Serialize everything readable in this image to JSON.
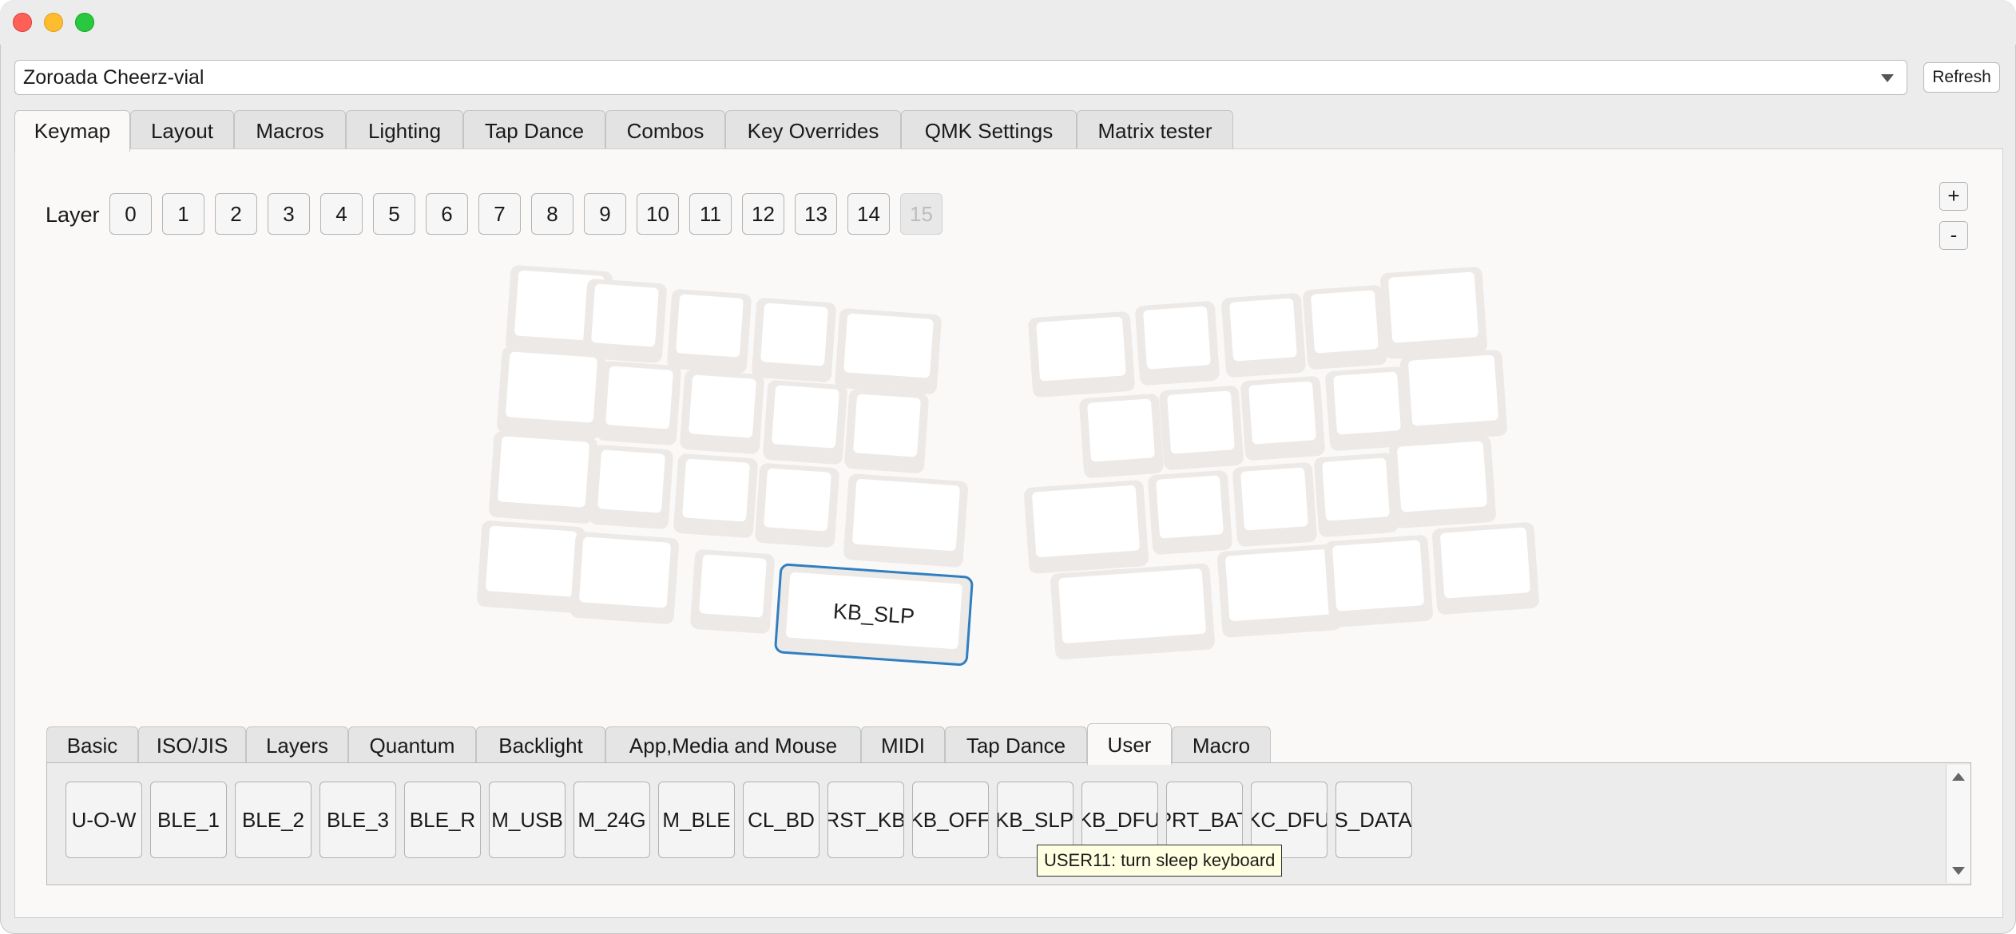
{
  "window": {
    "traffic_lights": [
      "close",
      "minimize",
      "maximize"
    ]
  },
  "device": {
    "selected": "Zoroada Cheerz-vial",
    "refresh_label": "Refresh"
  },
  "tabs": [
    "Keymap",
    "Layout",
    "Macros",
    "Lighting",
    "Tap Dance",
    "Combos",
    "Key Overrides",
    "QMK Settings",
    "Matrix tester"
  ],
  "active_tab": "Keymap",
  "layers": {
    "label": "Layer",
    "buttons": [
      "0",
      "1",
      "2",
      "3",
      "4",
      "5",
      "6",
      "7",
      "8",
      "9",
      "10",
      "11",
      "12",
      "13",
      "14",
      "15"
    ],
    "disabled": [
      "15"
    ],
    "plus": "+",
    "minus": "-"
  },
  "keyboard": {
    "selected_key_label": "KB_SLP",
    "selected_color": "#2f7fc1"
  },
  "keycode_tabs": [
    "Basic",
    "ISO/JIS",
    "Layers",
    "Quantum",
    "Backlight",
    "App,Media and Mouse",
    "MIDI",
    "Tap Dance",
    "User",
    "Macro"
  ],
  "active_keycode_tab": "User",
  "user_keycodes": [
    "U-O-W",
    "BLE_1",
    "BLE_2",
    "BLE_3",
    "BLE_R",
    "M_USB",
    "M_24G",
    "M_BLE",
    "CL_BD",
    "RST_KB",
    "KB_OFF",
    "KB_SLP",
    "KB_DFU",
    "PRT_BAT",
    "KC_DFU",
    "S_DATA"
  ],
  "tooltip": "USER11: turn sleep keyboard"
}
